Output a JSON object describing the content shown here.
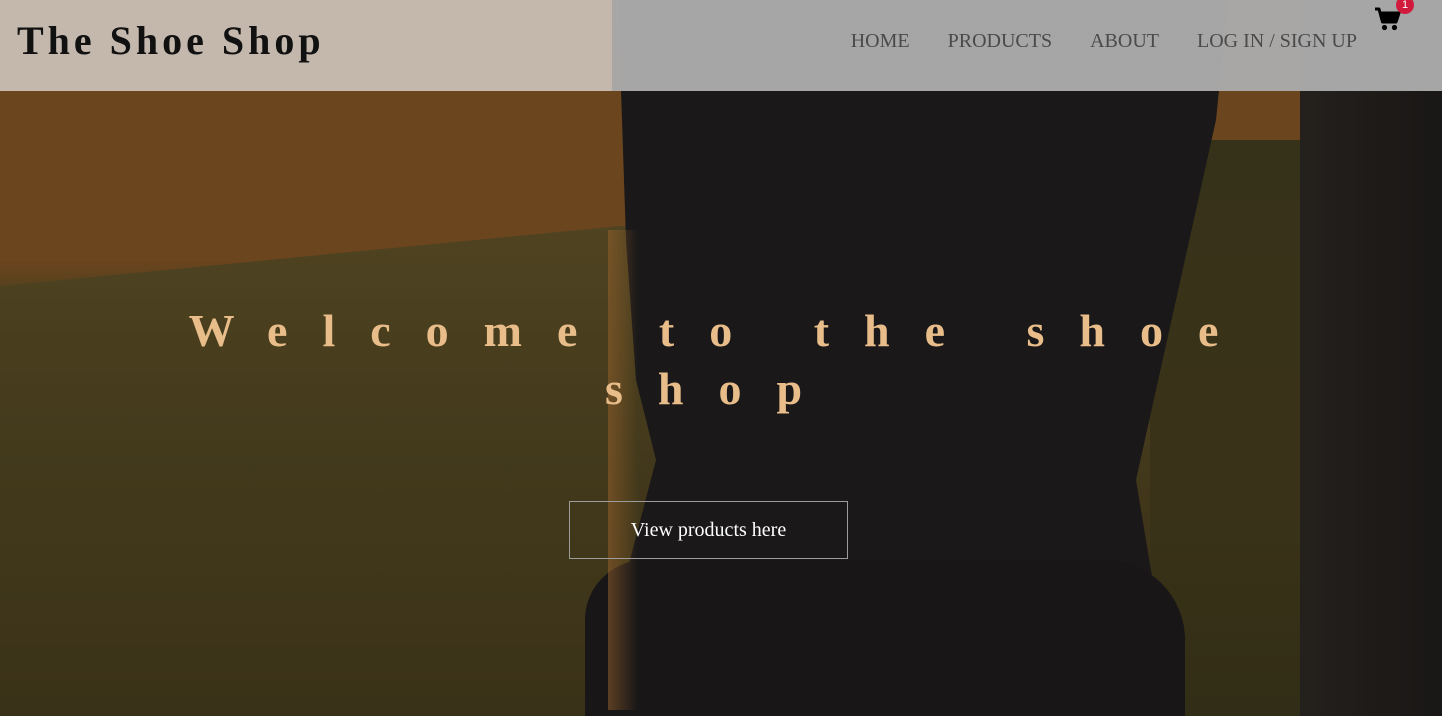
{
  "brand": {
    "name": "The Shoe Shop"
  },
  "nav": {
    "links": [
      "HOME",
      "PRODUCTS",
      "ABOUT",
      "LOG IN / SIGN UP"
    ]
  },
  "cart": {
    "icon": "shopping-cart-icon",
    "count": "1",
    "badge_color": "#d11b3c"
  },
  "hero": {
    "title": "Welcome to the shoe shop",
    "cta_label": "View products here"
  },
  "colors": {
    "navbar": "#c7bcb2",
    "title": "#e8bd8a",
    "cta_text": "#ffffff"
  }
}
